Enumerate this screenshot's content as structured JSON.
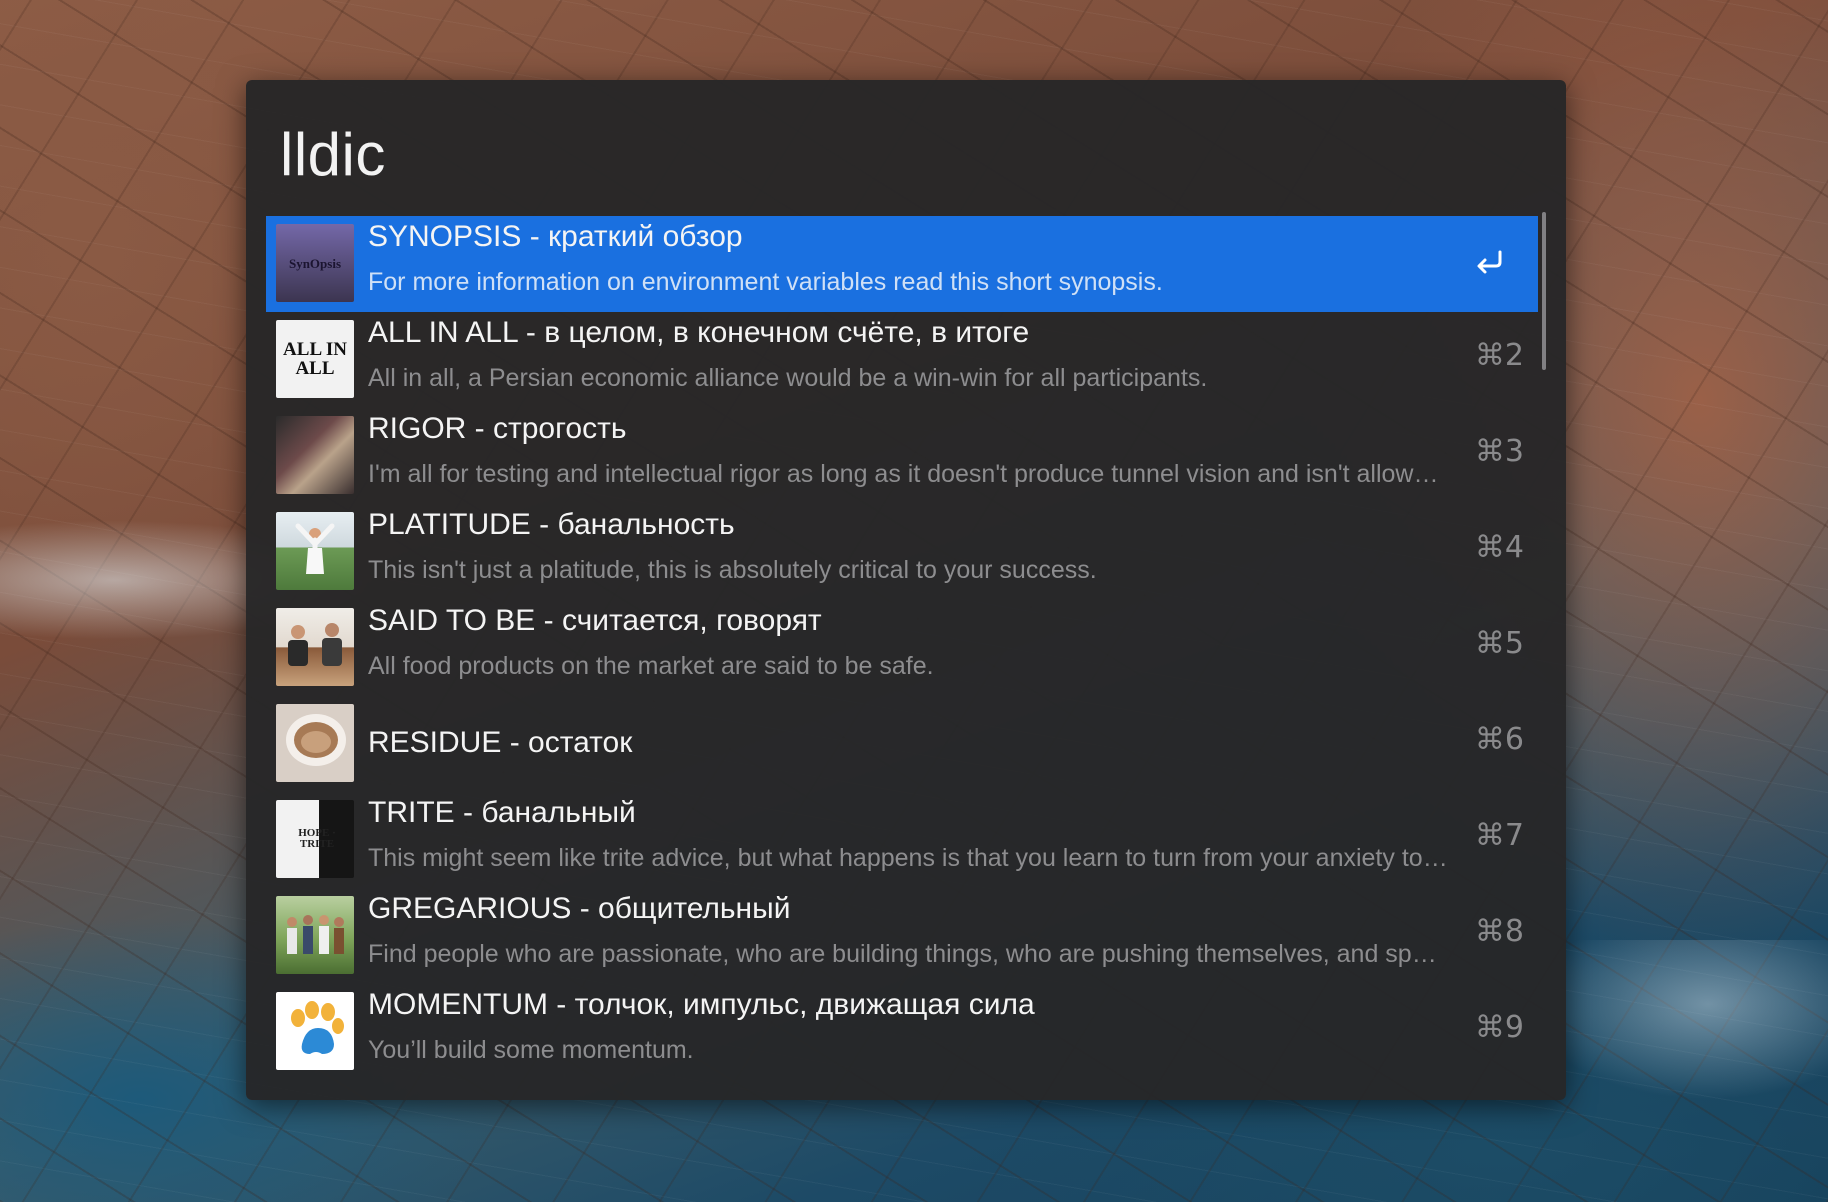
{
  "query": "lldic",
  "results": [
    {
      "title": "SYNOPSIS - краткий обзор",
      "subtitle": "For more information on environment variables read this short synopsis.",
      "shortcut": "",
      "selected": true,
      "thumb": {
        "icon": "synopsis-thumbnail",
        "label": "SynOpsis",
        "bg": "#6a5f90"
      }
    },
    {
      "title": "ALL IN ALL - в целом, в конечном счёте, в итоге",
      "subtitle": "All in all, a Persian economic alliance would be a win-win for all participants.",
      "shortcut": "⌘2",
      "thumb": {
        "icon": "all-in-all-thumbnail",
        "label": "ALL IN ALL",
        "bg": "#f2f2f2"
      }
    },
    {
      "title": "RIGOR - строгость",
      "subtitle": "I'm all for testing and intellectual rigor as long as it doesn't produce tunnel vision and isn't allowed to slow progress.",
      "shortcut": "⌘3",
      "thumb": {
        "icon": "crowd-photo-thumbnail",
        "label": "",
        "bg": "#4a3a3a"
      }
    },
    {
      "title": "PLATITUDE - банальность",
      "subtitle": "This isn't just a platitude, this is absolutely critical to your success.",
      "shortcut": "⌘4",
      "thumb": {
        "icon": "woman-arms-raised-thumbnail",
        "label": "",
        "bg": "#7fa86a"
      }
    },
    {
      "title": "SAID TO BE - считается, говорят",
      "subtitle": "All food products on the market  are said to be safe.",
      "shortcut": "⌘5",
      "thumb": {
        "icon": "two-men-sofa-thumbnail",
        "label": "",
        "bg": "#8a6a50"
      }
    },
    {
      "title": "RESIDUE - остаток",
      "subtitle": "",
      "shortcut": "⌘6",
      "thumb": {
        "icon": "coffee-cup-thumbnail",
        "label": "",
        "bg": "#b89a84"
      }
    },
    {
      "title": "TRITE - банальный",
      "subtitle": "This might seem like trite advice, but what happens is that you learn to turn from your anxiety to a state of calm.",
      "shortcut": "⌘7",
      "thumb": {
        "icon": "trite-book-cover-thumbnail",
        "label": "HOPE · TRITE",
        "bg": "#1a1a1a"
      }
    },
    {
      "title": "GREGARIOUS - общительный",
      "subtitle": "Find people who are passionate, who are building things, who are pushing themselves, and spend time with them.",
      "shortcut": "⌘8",
      "thumb": {
        "icon": "group-of-friends-thumbnail",
        "label": "",
        "bg": "#5f7e48"
      }
    },
    {
      "title": "MOMENTUM - толчок, импульс, движащая сила",
      "subtitle": "You’ll build some momentum.",
      "shortcut": "⌘9",
      "thumb": {
        "icon": "paw-print-thumbnail",
        "label": "",
        "bg": "#ffffff"
      }
    }
  ],
  "colors": {
    "panel_bg": "#262628",
    "selection": "#1a70e0",
    "title_text": "#f4f4f4",
    "subtitle_text": "#8d8d8f"
  }
}
